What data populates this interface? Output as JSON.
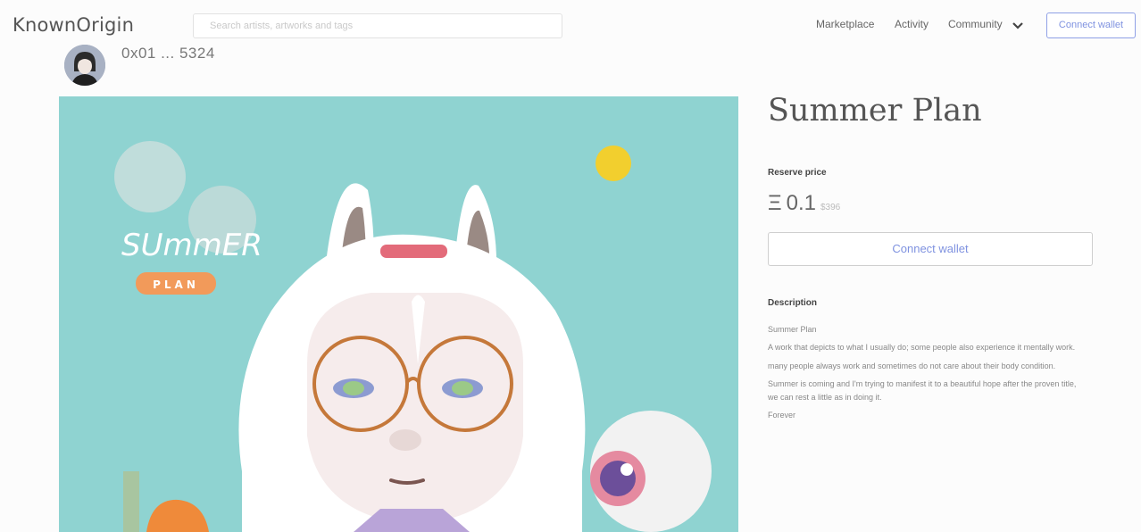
{
  "header": {
    "logo": "KnownOrigin",
    "search_placeholder": "Search artists, artworks and tags",
    "nav": {
      "marketplace": "Marketplace",
      "activity": "Activity",
      "community": "Community",
      "connect_wallet": "Connect wallet"
    }
  },
  "owner": {
    "address": "0x01 ... 5324"
  },
  "artwork": {
    "alt": "Summer Plan artwork",
    "colors": {
      "background": "#8fd3d1",
      "hair": "#ffffff",
      "glasses": "#c5783a",
      "sun": "#f2cf2e",
      "badge": "#f29a5a"
    },
    "lettering": {
      "word": "SUmmER",
      "badge": "PLAN"
    }
  },
  "detail": {
    "title": "Summer Plan",
    "reserve_label": "Reserve price",
    "eth_symbol": "Ξ",
    "price": "0.1",
    "price_fiat": "$396",
    "connect_wallet": "Connect wallet",
    "description_label": "Description",
    "description": [
      "Summer Plan",
      "A work that depicts to what I usually do; some people also experience it mentally work.",
      "many people always work and sometimes do not care about their body condition.",
      "Summer is coming and I'm trying to manifest it to a beautiful hope after the proven title, we can rest a little as in doing it.",
      "Forever"
    ]
  }
}
